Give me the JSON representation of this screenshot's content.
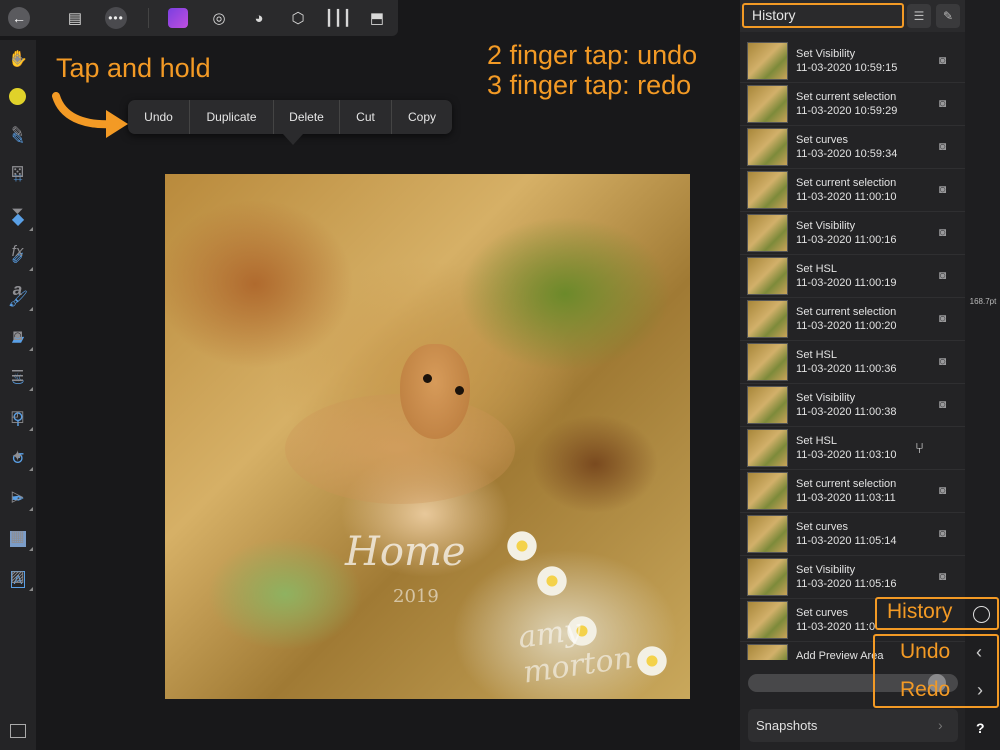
{
  "toolbar": {
    "back_icon": "arrow-left-icon",
    "document_icon": "document-icon",
    "more_icon": "ellipsis-icon",
    "personas": [
      "photo-persona-icon",
      "liquify-persona-icon",
      "develop-persona-icon",
      "tone-mapping-persona-icon",
      "export-persona-icon",
      "share-icon"
    ]
  },
  "left_tools": [
    "hand-icon",
    "move-icon",
    "color-picker-icon",
    "crop-icon",
    "fill-icon",
    "selection-brush-icon",
    "paint-brush-icon",
    "eraser-icon",
    "dodge-icon",
    "clone-icon",
    "healing-icon",
    "pen-icon",
    "rectangle-icon",
    "text-icon"
  ],
  "context_menu": {
    "items": [
      "Undo",
      "Duplicate",
      "Delete",
      "Cut",
      "Copy"
    ]
  },
  "annotations": {
    "tap_hold": "Tap and hold",
    "gesture_undo": "2 finger tap: undo",
    "gesture_redo": "3 finger tap: redo",
    "history_label": "History",
    "undo_label": "Undo",
    "redo_label": "Redo",
    "accent_color": "#f39a25"
  },
  "canvas": {
    "watermark_title": "Home",
    "watermark_year": "2019",
    "watermark_signature": "amy morton"
  },
  "history_panel": {
    "title": "History",
    "entries": [
      {
        "name": "Set Visibility",
        "time": "11-03-2020 10:59:15",
        "icon": "camera-icon"
      },
      {
        "name": "Set current selection",
        "time": "11-03-2020 10:59:29",
        "icon": "camera-icon"
      },
      {
        "name": "Set curves",
        "time": "11-03-2020 10:59:34",
        "icon": "camera-icon"
      },
      {
        "name": "Set current selection",
        "time": "11-03-2020 11:00:10",
        "icon": "camera-icon"
      },
      {
        "name": "Set Visibility",
        "time": "11-03-2020 11:00:16",
        "icon": "camera-icon"
      },
      {
        "name": "Set HSL",
        "time": "11-03-2020 11:00:19",
        "icon": "camera-icon"
      },
      {
        "name": "Set current selection",
        "time": "11-03-2020 11:00:20",
        "icon": "camera-icon"
      },
      {
        "name": "Set HSL",
        "time": "11-03-2020 11:00:36",
        "icon": "camera-icon"
      },
      {
        "name": "Set Visibility",
        "time": "11-03-2020 11:00:38",
        "icon": "camera-icon"
      },
      {
        "name": "Set HSL",
        "time": "11-03-2020 11:03:10",
        "icon": "branch-icon"
      },
      {
        "name": "Set current selection",
        "time": "11-03-2020 11:03:11",
        "icon": "camera-icon"
      },
      {
        "name": "Set curves",
        "time": "11-03-2020 11:05:14",
        "icon": "camera-icon"
      },
      {
        "name": "Set Visibility",
        "time": "11-03-2020 11:05:16",
        "icon": "camera-icon"
      },
      {
        "name": "Set curves",
        "time": "11-03-2020 11:0",
        "icon": ""
      },
      {
        "name": "Add Preview Area",
        "time": "",
        "icon": ""
      }
    ],
    "snapshots_label": "Snapshots"
  },
  "studio": {
    "font_size_label": "168.7pt",
    "help_label": "?",
    "color_swatch": "#e0d22a"
  }
}
